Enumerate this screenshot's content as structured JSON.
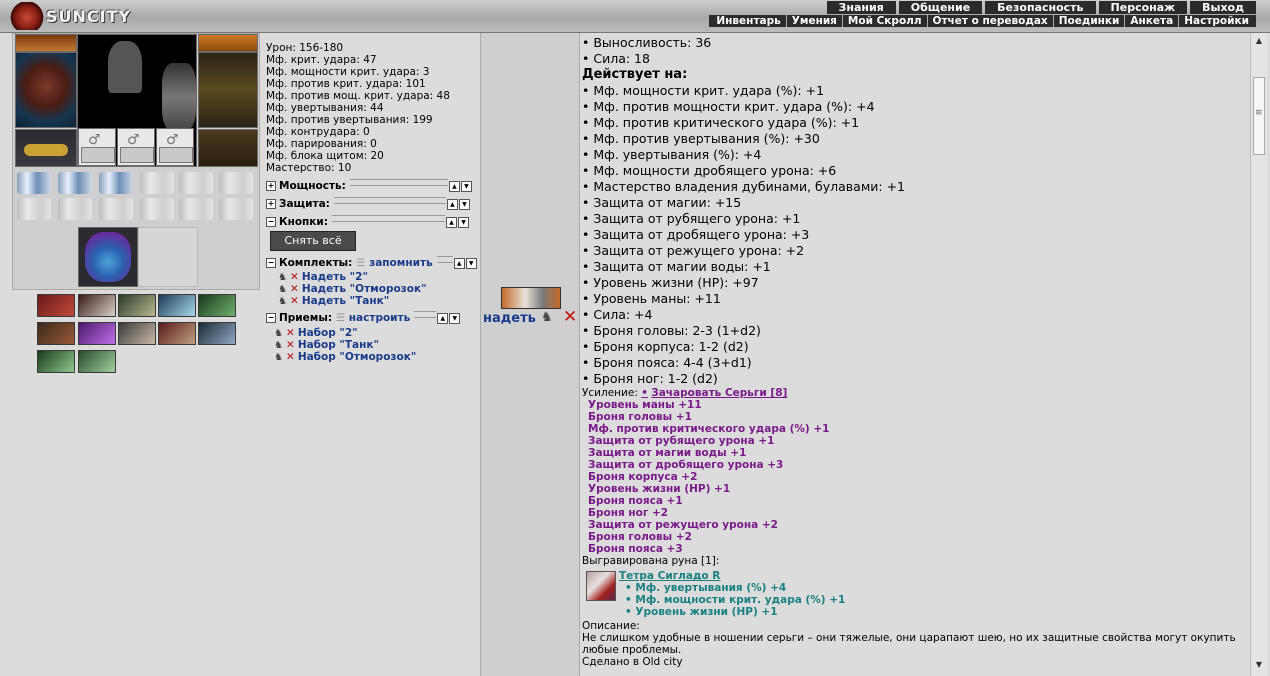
{
  "logo": {
    "text": "SUNCITY"
  },
  "menu_top": [
    "Знания",
    "Общение",
    "Безопасность",
    "Персонаж",
    "Выход"
  ],
  "menu_bottom": [
    "Инвентарь",
    "Умения",
    "Мой Скролл",
    "Отчет о переводах",
    "Поединки",
    "Анкета",
    "Настройки"
  ],
  "stats": {
    "lines": [
      "Урон: 156-180",
      "Мф. крит. удара: 47",
      "Мф. мощности крит. удара: 3",
      "Мф. против крит. удара: 101",
      "Мф. против мощ. крит. удара: 48",
      "Мф. увертывания: 44",
      "Мф. против увертывания: 199",
      "Мф. контрудара: 0",
      "Мф. парирования: 0",
      "Мф. блока щитом: 20",
      "Мастерство: 10"
    ],
    "sections": {
      "power": "Мощность:",
      "defense": "Защита:",
      "buttons": "Кнопки:",
      "sets": "Комплекты:",
      "sets_link": "запомнить",
      "moves": "Приемы:",
      "moves_link": "настроить"
    },
    "takeoff_button": "Снять всё",
    "sets": [
      "Надеть \"2\"",
      "Надеть \"Отморозок\"",
      "Надеть \"Танк\""
    ],
    "moves": [
      "Набор \"2\"",
      "Набор \"Танк\"",
      "Набор \"Отморозок\""
    ]
  },
  "equip": {
    "label": "надеть"
  },
  "detail": {
    "requirements": [
      "• Выносливость: 36",
      "• Сила: 18"
    ],
    "acts_title": "Действует на:",
    "acts": [
      "• Мф. мощности крит. удара (%): +1",
      "• Мф. против мощности крит. удара (%): +4",
      "• Мф. против критического удара (%): +1",
      "• Мф. против увертывания (%): +30",
      "• Мф. увертывания (%): +4",
      "• Мф. мощности дробящего урона: +6",
      "• Мастерство владения дубинами, булавами: +1",
      "• Защита от магии: +15",
      "• Защита от рубящего урона: +1",
      "• Защита от дробящего урона: +3",
      "• Защита от режущего урона: +2",
      "• Защита от магии воды: +1",
      "• Уровень жизни (HP): +97",
      "• Уровень маны: +11",
      "• Сила: +4",
      "• Броня головы: 2-3 (1+d2)",
      "• Броня корпуса: 1-2 (d2)",
      "• Броня пояса: 4-4 (3+d1)",
      "• Броня ног: 1-2 (d2)"
    ],
    "enh_label": "Усиление:",
    "enh_link": "Зачаровать Серьги [8]",
    "enhancements": [
      "Уровень маны +11",
      "Броня головы +1",
      "Мф. против критического удара (%) +1",
      "Защита от рубящего урона +1",
      "Защита от магии воды +1",
      "Защита от дробящего урона +3",
      "Броня корпуса +2",
      "Уровень жизни (HP) +1",
      "Броня пояса +1",
      "Броня ног +2",
      "Защита от режущего урона +2",
      "Броня головы +2",
      "Броня пояса +3"
    ],
    "rune_label": "Выгравирована руна [1]:",
    "rune_name": "Тетра Сиглaдо R",
    "rune_props": [
      "• Мф. увертывания (%) +4",
      "• Мф. мощности крит. удара (%) +1",
      "• Уровень жизни (HP) +1"
    ],
    "desc_label": "Описание:",
    "desc_text": "Не слишком удобные в ношении серьги – они тяжелые, они царапают шею, но их защитные свойства могут окупить",
    "desc_text2": "любые проблемы.",
    "made_in": "Сделано в Old city"
  }
}
